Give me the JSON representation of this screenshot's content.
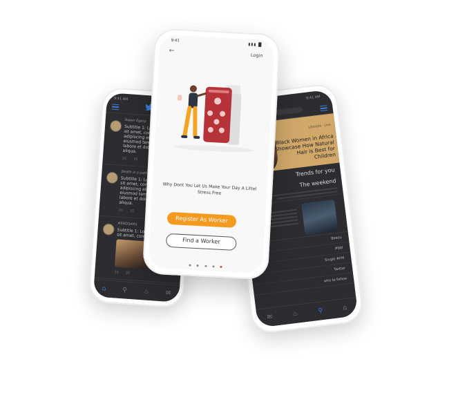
{
  "left_phone": {
    "status_time": "9:41 AM",
    "tweets": [
      {
        "name": "Ikwen Egerp",
        "body": "Subtitle 1: Lorem ipsum dolor sit amet, consectetur adipiscing elit, sed do eiusmod tempor incididunt ut labore et dolore magna aliqua.",
        "replies": "20",
        "retweets": "35"
      },
      {
        "name": "Death is a path way",
        "body": "Subtitle 1: Lorem ipsum dolor sit amet, consectetur adipiscing elit, sed do eiusmod tempor incididunt ut labore et dolore magna aliqua.",
        "replies": "20",
        "retweets": "35"
      },
      {
        "name": "#ENDSARS",
        "body": "Subtitle 1: Lorem ipsum dolor sit amet, consectetur adipiscing elit, sed do eiusmod tempor incididunt ut labore et dolore magna aliqua.",
        "replies": "20",
        "retweets": "35"
      }
    ],
    "nav": [
      "home-icon",
      "search-icon",
      "bell-icon",
      "mail-icon"
    ]
  },
  "center_phone": {
    "status_time": "9:41",
    "login_label": "Login",
    "tagline": "Why Dont You Let Us Make Your Day A Littel Stress Free",
    "register_label": "Register As Worker",
    "find_label": "Find a Worker",
    "pager_count": 5,
    "pager_active": 4,
    "accent": "#f39a1f"
  },
  "right_phone": {
    "status_time": "9:41 AM",
    "hero_kicker": "Lifestyle · Live",
    "hero_text": "Black Women in Africa Showcase How Natural Hair is Best for Children",
    "trends_label": "Trends for you",
    "weekend_label": "The weekend",
    "list": [
      "Beezu",
      "#bbl",
      "Single #FM",
      "Twitter",
      "who to follow"
    ],
    "nav": [
      "mail-icon",
      "bell-icon",
      "search-icon",
      "home-icon"
    ]
  }
}
